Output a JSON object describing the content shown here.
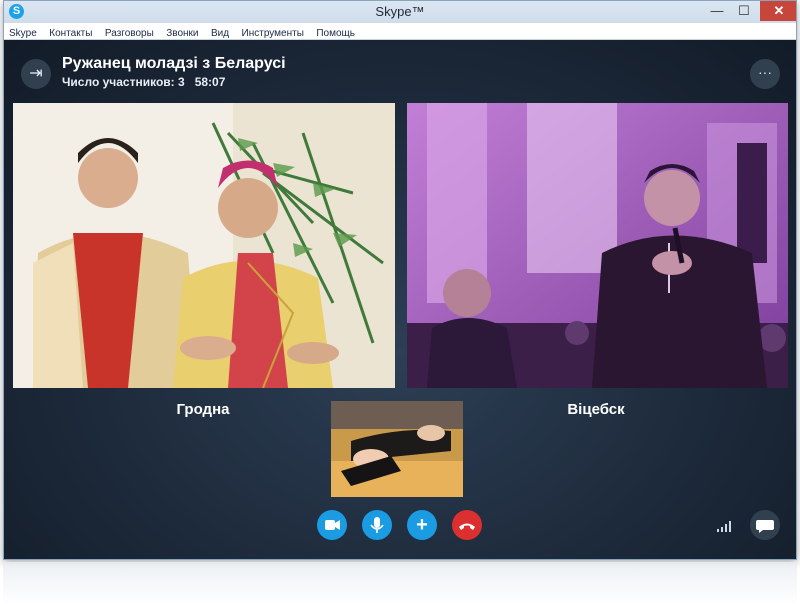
{
  "window": {
    "title": "Skype™",
    "app_icon": "S",
    "controls": {
      "minimize": "—",
      "maximize": "☐",
      "close": "✕"
    }
  },
  "menu": [
    "Skype",
    "Контакты",
    "Разговоры",
    "Звонки",
    "Вид",
    "Инструменты",
    "Помощь"
  ],
  "call": {
    "title": "Ружанец моладзі з Беларусі",
    "participants_label": "Число участников: 3",
    "duration": "58:07",
    "back_icon": "exit-call-icon",
    "more_icon": "more-options-icon",
    "more_glyph": "···",
    "back_glyph": "⇥"
  },
  "videos": [
    {
      "caption": "Гродна"
    },
    {
      "caption": "Віцебск"
    }
  ],
  "controls": {
    "video_icon": "video-camera-icon",
    "mic_icon": "microphone-icon",
    "add_icon": "plus-icon",
    "add_glyph": "+",
    "end_icon": "hang-up-icon",
    "chat_icon": "chat-bubble-icon"
  },
  "colors": {
    "accent": "#1a9be2",
    "end_call": "#dc2f2f",
    "background": "#1d2a3b"
  }
}
